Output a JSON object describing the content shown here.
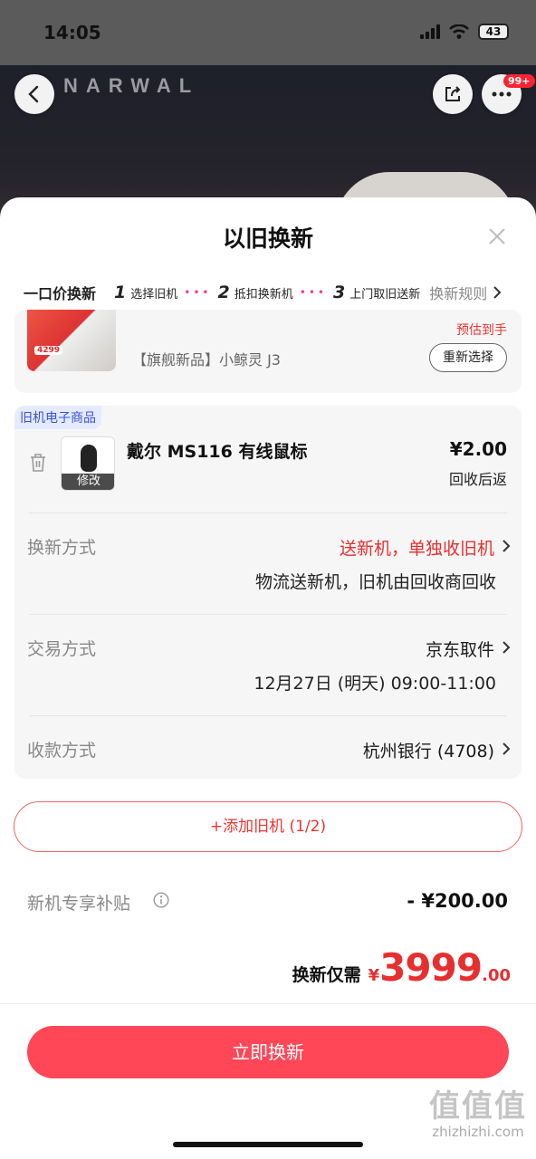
{
  "status_bar": {
    "time": "14:05",
    "battery": "43"
  },
  "header": {
    "brand": "NARWAL",
    "more_badge": "99+"
  },
  "sheet": {
    "title": "以旧换新",
    "steps": {
      "title": "一口价换新",
      "items": [
        {
          "num": "1",
          "label": "选择旧机"
        },
        {
          "num": "2",
          "label": "抵扣换新机"
        },
        {
          "num": "3",
          "label": "上门取旧送新"
        }
      ],
      "rules": "换新规则"
    },
    "new_product": {
      "name": "【旗舰新品】小鲸灵 J3",
      "estimate_label": "预估到手",
      "reselect_label": "重新选择",
      "thumb_price": "4299"
    },
    "old_device": {
      "tag": "旧机电子商品",
      "name": "戴尔 MS116 有线鼠标",
      "price": "¥2.00",
      "price_note": "回收后返",
      "edit_label": "修改",
      "rows": [
        {
          "label": "换新方式",
          "value": "送新机，单独收旧机",
          "sub": "物流送新机，旧机由回收商回收"
        },
        {
          "label": "交易方式",
          "value": "京东取件",
          "sub": "12月27日 (明天) 09:00-11:00"
        },
        {
          "label": "收款方式",
          "value": "杭州银行 (4708)"
        }
      ]
    },
    "add_button": "+添加旧机 (1/2)",
    "subsidy": {
      "label": "新机专享补贴",
      "value": "- ¥200.00"
    },
    "total": {
      "label": "换新仅需",
      "currency": "¥",
      "integer": "3999",
      "decimal": ".00"
    },
    "cta": "立即换新"
  },
  "watermark": {
    "logo": "值值值",
    "domain": "zhizhizhi.com"
  }
}
